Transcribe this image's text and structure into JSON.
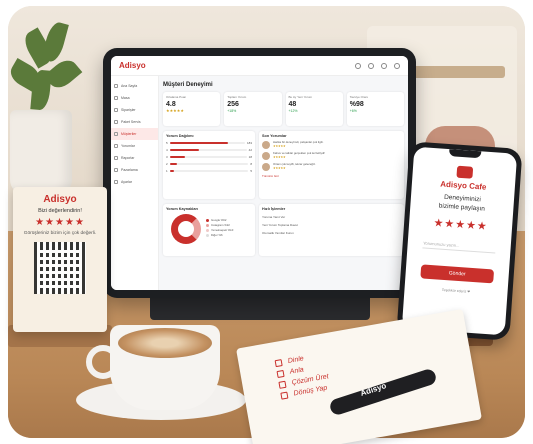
{
  "tablet": {
    "logo": "Adisyo",
    "page_title": "Müşteri Deneyimi",
    "sidebar": [
      {
        "label": "Ana Sayfa"
      },
      {
        "label": "Masa"
      },
      {
        "label": "Siparişler"
      },
      {
        "label": "Paket Servis"
      },
      {
        "label": "Müşteriler"
      },
      {
        "label": "Yorumlar"
      },
      {
        "label": "Raporlar"
      },
      {
        "label": "Pazarlama"
      },
      {
        "label": "Ayarlar"
      }
    ],
    "kpis": [
      {
        "label": "Ortalama Puan",
        "value": "4.8",
        "delta": "★★★★★"
      },
      {
        "label": "Toplam Yorum",
        "value": "256",
        "delta": "+18%"
      },
      {
        "label": "Bu Ay Yeni Yorum",
        "value": "48",
        "delta": "+12%"
      },
      {
        "label": "Tavsiye Oranı",
        "value": "%98",
        "delta": "+6%"
      }
    ],
    "rating_card": {
      "title": "Yorum Dağılımı",
      "rows": [
        {
          "star": "5",
          "count": "183",
          "pct": 0.78
        },
        {
          "star": "4",
          "count": "42",
          "pct": 0.38
        },
        {
          "star": "3",
          "count": "18",
          "pct": 0.2
        },
        {
          "star": "2",
          "count": "8",
          "pct": 0.09
        },
        {
          "star": "1",
          "count": "5",
          "pct": 0.05
        }
      ]
    },
    "reviews_card": {
      "title": "Son Yorumlar",
      "reviews": [
        {
          "text": "Harika bir deneyimdi, çalışanlar çok ilgili.",
          "stars": "★★★★★"
        },
        {
          "text": "Kahve ve tatlılar gerçekten çok lezzetliydi!",
          "stars": "★★★★★"
        },
        {
          "text": "Ortam çok keyifli, tekrar geleceğiz.",
          "stars": "★★★★★"
        }
      ],
      "link": "Tümünü Gör"
    },
    "sources_card": {
      "title": "Yorum Kaynakları",
      "items": [
        "Google %62",
        "Instagram %22",
        "Yemeksepeti %10",
        "Diğer %6"
      ]
    },
    "actions_card": {
      "title": "Hızlı İşlemler",
      "items": [
        "Yoruma Yanıt Ver",
        "Yeni Yorum Toplama Davet",
        "Otomatik Yanıtlar Kurun"
      ]
    }
  },
  "phone": {
    "brand": "Adisyo Cafe",
    "message_line1": "Deneyiminizi",
    "message_line2": "bizimle paylaşın",
    "stars": "★★★★★",
    "input_placeholder": "Yorumunuzu yazın...",
    "button": "Gönder",
    "footer": "Teşekkür ederiz ❤"
  },
  "sign": {
    "brand": "Adisyo",
    "headline": "Bizi değerlendirin!",
    "stars": "★★★★★",
    "subtitle": "Görüşleriniz bizim için çok değerli."
  },
  "notebook": {
    "items": [
      "Dinle",
      "Anla",
      "Çözüm Üret",
      "Dönüş Yap"
    ]
  },
  "pen": {
    "label": "Adisyo"
  }
}
